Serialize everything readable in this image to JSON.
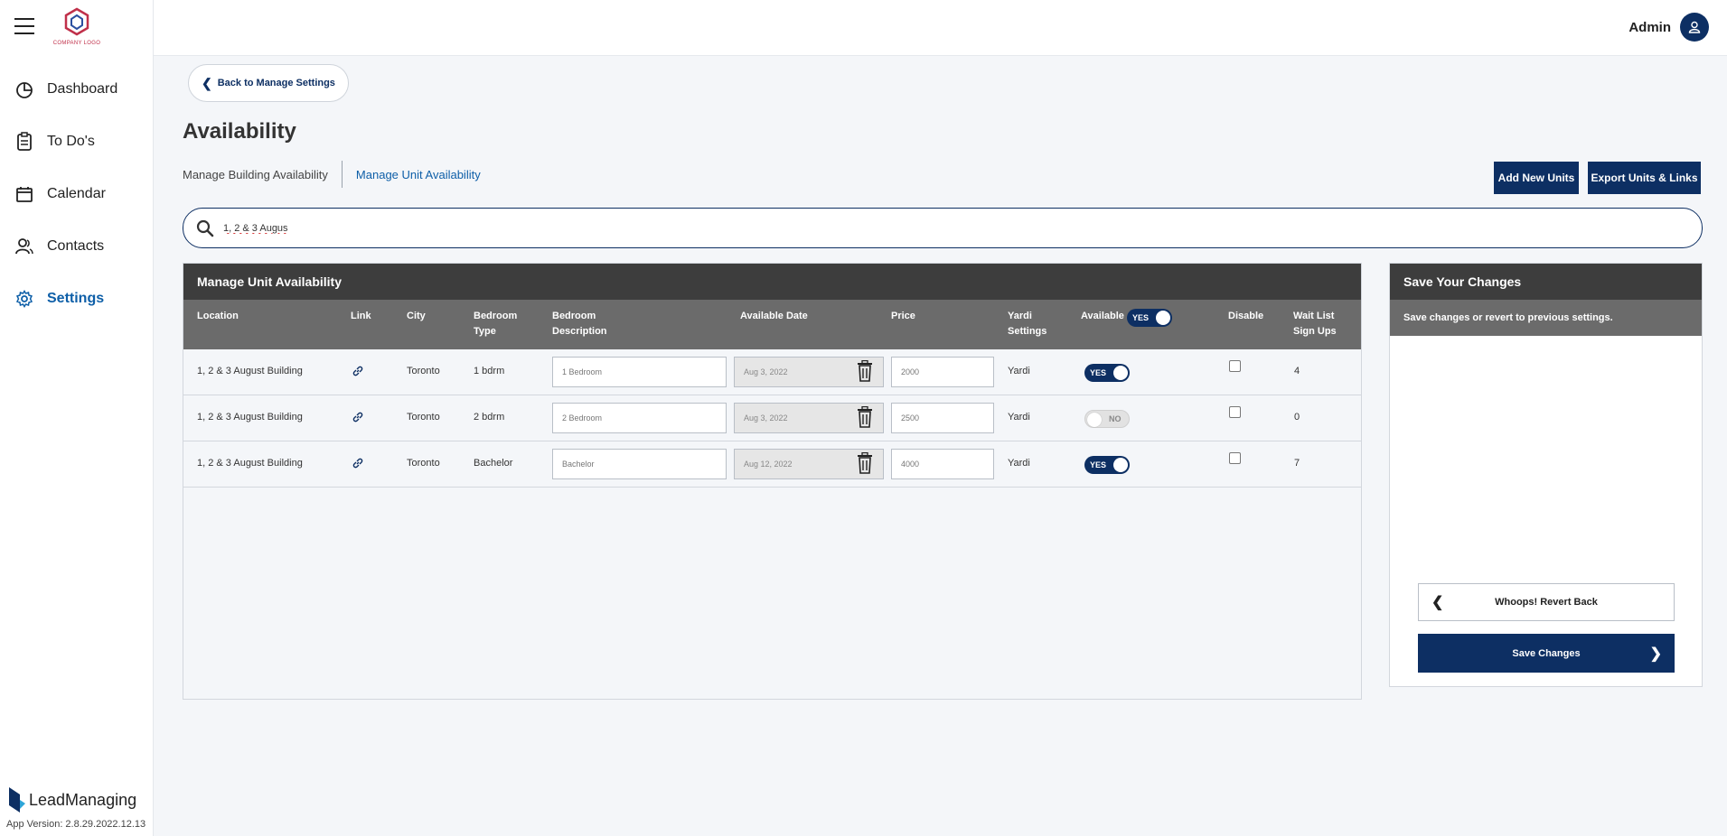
{
  "app": {
    "logo_text": "COMPANY LOGO",
    "brand_name": "LeadManaging",
    "version": "App Version: 2.8.29.2022.12.13",
    "user_name": "Admin"
  },
  "sidebar": {
    "items": [
      {
        "label": "Dashboard",
        "icon": "pie-chart-icon",
        "active": false
      },
      {
        "label": "To Do's",
        "icon": "clipboard-icon",
        "active": false
      },
      {
        "label": "Calendar",
        "icon": "calendar-icon",
        "active": false
      },
      {
        "label": "Contacts",
        "icon": "contacts-icon",
        "active": false
      },
      {
        "label": "Settings",
        "icon": "gear-icon",
        "active": true
      }
    ]
  },
  "page": {
    "back_label": "Back to Manage Settings",
    "title": "Availability",
    "subtabs": [
      "Manage Building Availability",
      "Manage Unit Availability"
    ],
    "add_units_label": "Add New Units",
    "export_label": "Export Units & Links",
    "search_value": "1, 2 & 3 Augus"
  },
  "table": {
    "panel_title": "Manage Unit Availability",
    "headers": {
      "location": "Location",
      "link": "Link",
      "city": "City",
      "bedroom_type": [
        "Bedroom",
        "Type"
      ],
      "bedroom_desc": [
        "Bedroom",
        "Description"
      ],
      "available_date": "Available Date",
      "price": "Price",
      "yardi": [
        "Yardi",
        "Settings"
      ],
      "available": "Available",
      "available_toggle": "YES",
      "disable": "Disable",
      "waitlist": [
        "Wait List",
        "Sign Ups"
      ]
    },
    "rows": [
      {
        "location": "1, 2 & 3 August Building",
        "city": "Toronto",
        "bedroom_type": "1 bdrm",
        "description": "1 Bedroom",
        "date": "Aug 3, 2022",
        "price": "2000",
        "yardi": "Yardi",
        "available": "YES",
        "waitlist": "4"
      },
      {
        "location": "1, 2 & 3 August Building",
        "city": "Toronto",
        "bedroom_type": "2 bdrm",
        "description": "2 Bedroom",
        "date": "Aug 3, 2022",
        "price": "2500",
        "yardi": "Yardi",
        "available": "NO",
        "waitlist": "0"
      },
      {
        "location": "1, 2 & 3 August Building",
        "city": "Toronto",
        "bedroom_type": "Bachelor",
        "description": "Bachelor",
        "date": "Aug 12, 2022",
        "price": "4000",
        "yardi": "Yardi",
        "available": "YES",
        "waitlist": "7"
      }
    ]
  },
  "save_panel": {
    "title": "Save Your Changes",
    "subtitle": "Save changes or revert to previous settings.",
    "revert_label": "Whoops! Revert Back",
    "save_label": "Save Changes"
  },
  "colors": {
    "primary": "#0d2f63",
    "accent_link": "#0e5fa8",
    "panel_header": "#3d3d3d",
    "table_header": "#6b6b6b"
  }
}
